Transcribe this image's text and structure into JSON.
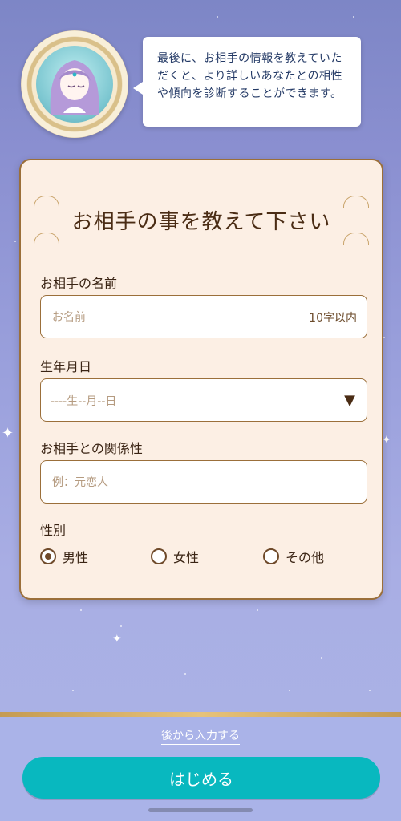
{
  "bubble": {
    "text": "最後に、お相手の情報を教えていただくと、より詳しいあなたとの相性や傾向を診断することができます。"
  },
  "card": {
    "title": "お相手の事を教えて下さい",
    "name": {
      "label": "お相手の名前",
      "placeholder": "お名前",
      "hint": "10字以内"
    },
    "birthdate": {
      "label": "生年月日",
      "value": "----生--月--日",
      "caret": "▼"
    },
    "relationship": {
      "label": "お相手との関係性",
      "placeholder": "例：元恋人"
    },
    "gender": {
      "label": "性別",
      "options": [
        "男性",
        "女性",
        "その他"
      ],
      "selected": "男性"
    }
  },
  "footer": {
    "later_link": "後から入力する",
    "start_button": "はじめる"
  },
  "colors": {
    "accent": "#08b8bf",
    "card_border": "#9b6f3a",
    "title_text": "#4a2c14"
  }
}
